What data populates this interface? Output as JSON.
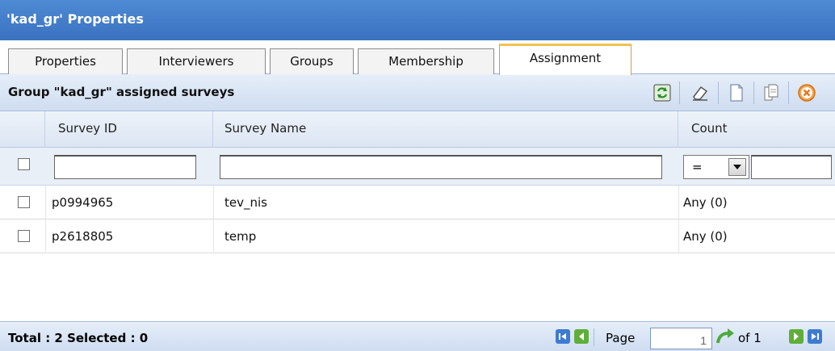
{
  "window": {
    "title": "'kad_gr' Properties"
  },
  "tabs": [
    {
      "label": "Properties",
      "active": false
    },
    {
      "label": "Interviewers",
      "active": false
    },
    {
      "label": "Groups",
      "active": false
    },
    {
      "label": "Membership",
      "active": false
    },
    {
      "label": "Assignment",
      "active": true
    }
  ],
  "toolbar": {
    "caption": "Group \"kad_gr\" assigned surveys",
    "icons": [
      "refresh-icon",
      "eraser-icon",
      "new-document-icon",
      "copy-document-icon",
      "delete-icon"
    ]
  },
  "grid": {
    "columns": [
      "Survey ID",
      "Survey Name",
      "Count"
    ],
    "filter": {
      "survey_id": "",
      "survey_name": "",
      "count_operator": "=",
      "count_value": ""
    },
    "rows": [
      {
        "survey_id": "p0994965",
        "survey_name": "tev_nis",
        "count": "Any (0)",
        "checked": false
      },
      {
        "survey_id": "p2618805",
        "survey_name": "temp",
        "count": "Any (0)",
        "checked": false
      }
    ]
  },
  "footer": {
    "summary": "Total : 2 Selected : 0",
    "page_label": "Page",
    "page_value": "1",
    "of_label": "of 1"
  },
  "colors": {
    "title_bar": "#3f7ac8",
    "active_tab_accent": "#f1c24e",
    "delete_icon": "#f08a1c",
    "nav_green": "#5fae3a",
    "nav_blue": "#3e7bd1"
  }
}
